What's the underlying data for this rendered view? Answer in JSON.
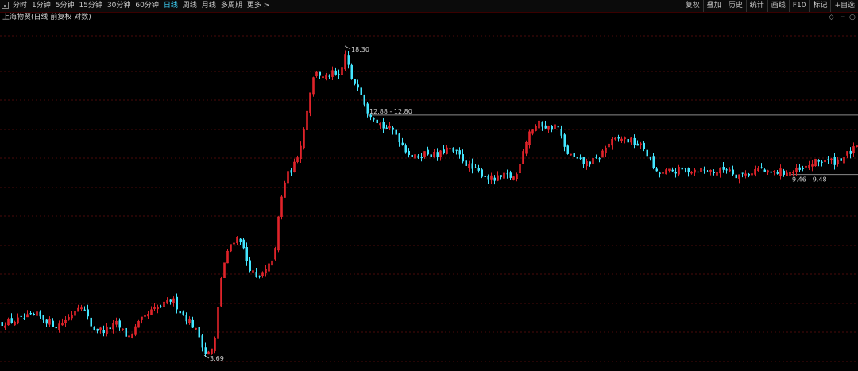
{
  "toolbar": {
    "periods": [
      {
        "label": "分时",
        "active": false
      },
      {
        "label": "1分钟",
        "active": false
      },
      {
        "label": "5分钟",
        "active": false
      },
      {
        "label": "15分钟",
        "active": false
      },
      {
        "label": "30分钟",
        "active": false
      },
      {
        "label": "60分钟",
        "active": false
      },
      {
        "label": "日线",
        "active": true
      },
      {
        "label": "周线",
        "active": false
      },
      {
        "label": "月线",
        "active": false
      },
      {
        "label": "多周期",
        "active": false
      },
      {
        "label": "更多 >",
        "active": false
      }
    ],
    "right_tools": [
      "复权",
      "叠加",
      "历史",
      "统计",
      "画线",
      "F10",
      "标记",
      "+自选"
    ]
  },
  "chart_header": {
    "title": "上海物贸",
    "subtitle": "(日线 前复权 对数)"
  },
  "colors": {
    "up": "#e0232a",
    "down": "#43e6ff",
    "grid": "#4a0a0a",
    "level_line": "#8a8a8a"
  },
  "chart_data": {
    "type": "candlestick",
    "title": "上海物贸",
    "y_scale": "log",
    "ylim": [
      3.5,
      20.5
    ],
    "max_label": "18.30",
    "min_label": "3.69",
    "annotations": [
      {
        "label": "12.88 - 12.80",
        "value": 12.84
      },
      {
        "label": "9.46 - 9.48",
        "value": 9.47
      }
    ],
    "close_path": [
      [
        0,
        4.42
      ],
      [
        20,
        4.48
      ],
      [
        45,
        4.6
      ],
      [
        70,
        4.35
      ],
      [
        85,
        4.55
      ],
      [
        100,
        4.9
      ],
      [
        115,
        4.3
      ],
      [
        130,
        4.25
      ],
      [
        145,
        4.4
      ],
      [
        160,
        4.1
      ],
      [
        175,
        4.45
      ],
      [
        190,
        4.7
      ],
      [
        205,
        4.85
      ],
      [
        215,
        5.0
      ],
      [
        225,
        4.7
      ],
      [
        240,
        4.4
      ],
      [
        250,
        4.1
      ],
      [
        258,
        3.75
      ],
      [
        268,
        3.9
      ],
      [
        278,
        5.8
      ],
      [
        290,
        6.7
      ],
      [
        300,
        6.9
      ],
      [
        310,
        6.0
      ],
      [
        322,
        5.5
      ],
      [
        335,
        5.8
      ],
      [
        345,
        6.4
      ],
      [
        350,
        7.9
      ],
      [
        358,
        9.3
      ],
      [
        370,
        10.0
      ],
      [
        380,
        11.6
      ],
      [
        388,
        14.3
      ],
      [
        396,
        16.2
      ],
      [
        406,
        15.4
      ],
      [
        416,
        15.9
      ],
      [
        426,
        15.5
      ],
      [
        434,
        17.8
      ],
      [
        440,
        15.3
      ],
      [
        450,
        15.0
      ],
      [
        460,
        13.2
      ],
      [
        470,
        12.7
      ],
      [
        480,
        12.1
      ],
      [
        495,
        11.8
      ],
      [
        510,
        10.7
      ],
      [
        520,
        10.3
      ],
      [
        535,
        10.6
      ],
      [
        550,
        10.4
      ],
      [
        560,
        10.8
      ],
      [
        575,
        10.5
      ],
      [
        590,
        9.8
      ],
      [
        605,
        9.5
      ],
      [
        620,
        9.2
      ],
      [
        635,
        9.4
      ],
      [
        648,
        9.3
      ],
      [
        655,
        10.5
      ],
      [
        665,
        11.8
      ],
      [
        678,
        12.3
      ],
      [
        690,
        12.0
      ],
      [
        700,
        12.2
      ],
      [
        710,
        10.7
      ],
      [
        720,
        10.3
      ],
      [
        735,
        10.0
      ],
      [
        750,
        10.2
      ],
      [
        765,
        11.1
      ],
      [
        780,
        11.4
      ],
      [
        795,
        11.2
      ],
      [
        810,
        10.8
      ],
      [
        825,
        9.5
      ],
      [
        840,
        9.6
      ],
      [
        860,
        9.7
      ],
      [
        880,
        9.7
      ],
      [
        900,
        9.6
      ],
      [
        915,
        9.8
      ],
      [
        925,
        9.45
      ],
      [
        940,
        9.5
      ],
      [
        955,
        9.8
      ],
      [
        965,
        9.5
      ],
      [
        980,
        9.6
      ],
      [
        995,
        9.55
      ],
      [
        1010,
        9.7
      ],
      [
        1020,
        10.0
      ],
      [
        1035,
        10.2
      ],
      [
        1050,
        10.1
      ],
      [
        1065,
        10.5
      ],
      [
        1075,
        10.8
      ]
    ]
  }
}
